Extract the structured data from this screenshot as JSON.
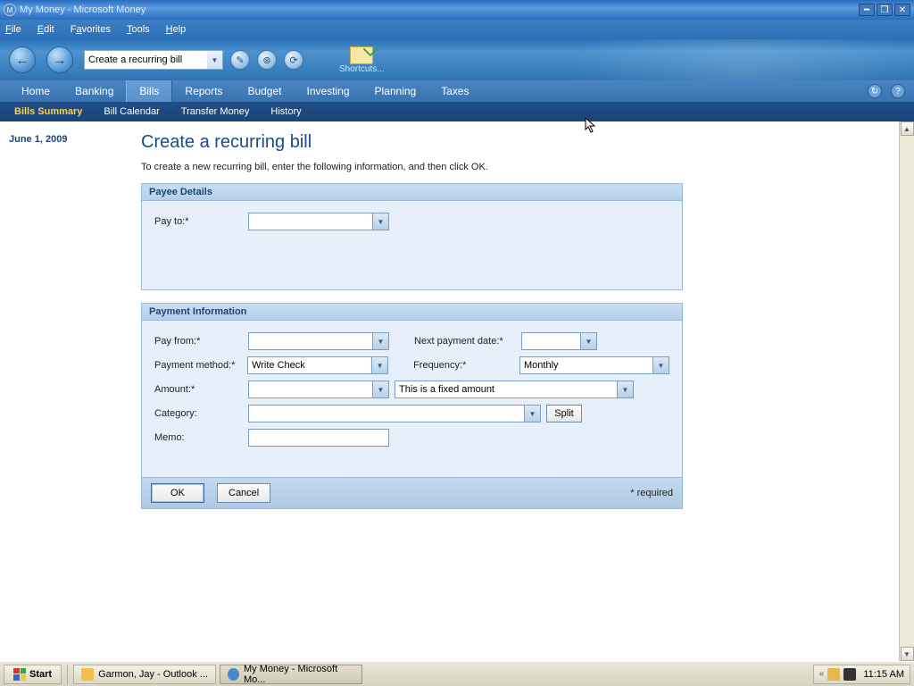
{
  "window": {
    "title": "My Money - Microsoft Money",
    "icon_letter": "M"
  },
  "menu": {
    "file": "File",
    "edit": "Edit",
    "favorites": "Favorites",
    "tools": "Tools",
    "help": "Help"
  },
  "toolbar": {
    "address": "Create a recurring bill",
    "shortcuts": "Shortcuts..."
  },
  "primnav": {
    "home": "Home",
    "banking": "Banking",
    "bills": "Bills",
    "reports": "Reports",
    "budget": "Budget",
    "investing": "Investing",
    "planning": "Planning",
    "taxes": "Taxes"
  },
  "subnav": {
    "summary": "Bills Summary",
    "calendar": "Bill Calendar",
    "transfer": "Transfer Money",
    "history": "History"
  },
  "sidebar": {
    "date": "June 1, 2009"
  },
  "page": {
    "title": "Create a recurring bill",
    "intro": "To create a new recurring bill, enter the following information, and then click OK.",
    "panel1": "Payee Details",
    "payto_label": "Pay to:*",
    "panel2": "Payment Information",
    "payfrom_label": "Pay from:*",
    "nextdate_label": "Next payment date:*",
    "paymethod_label": "Payment method:*",
    "paymethod_value": "Write Check",
    "freq_label": "Frequency:*",
    "freq_value": "Monthly",
    "amount_label": "Amount:*",
    "fixed_value": "This is a fixed amount",
    "category_label": "Category:",
    "split": "Split",
    "memo_label": "Memo:",
    "ok": "OK",
    "cancel": "Cancel",
    "required": "* required"
  },
  "taskbar": {
    "start": "Start",
    "task1": "Garmon, Jay - Outlook ...",
    "task2": "My Money - Microsoft Mo...",
    "clock": "11:15 AM",
    "chev": "«"
  }
}
